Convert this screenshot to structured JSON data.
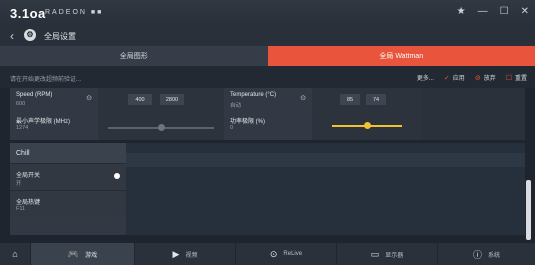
{
  "window": {
    "logo_mark": "3.1oa",
    "brand": "RADEON ■■",
    "controls": [
      "★",
      "—",
      "☐",
      "✕"
    ]
  },
  "nav": {
    "back": "‹",
    "global_icon": "⚙",
    "title": "全局设置"
  },
  "tabs": [
    {
      "label": "全局图形"
    },
    {
      "label": "全局 Wattman"
    }
  ],
  "toolbar": {
    "notice": "请在开始更改超频前验证...",
    "more": "更多...",
    "apply": "应用",
    "discard": "放弃",
    "reset": "重置"
  },
  "metrics": {
    "speed": {
      "label": "Speed (RPM)",
      "value": "600",
      "min": "400",
      "max": "2800"
    },
    "temperature": {
      "label": "Temperature (°C)",
      "value": "自动",
      "min": "85",
      "max": "74"
    },
    "min_noise": {
      "label": "最小声学极限 (MHz)",
      "value": "1274",
      "slider_level": 0.5
    },
    "power_limit": {
      "label": "功率极限 (%)",
      "value": "0",
      "slider_level": 0.5
    }
  },
  "chill": {
    "title": "Chill",
    "items": [
      {
        "title": "全局开关",
        "value": "开"
      },
      {
        "title": "全局热键",
        "value": "F11"
      }
    ]
  },
  "bottom_nav": [
    {
      "icon": "home-icon",
      "glyph": "⌂",
      "label": ""
    },
    {
      "icon": "gamepad-icon",
      "glyph": "🎮",
      "label": "游戏"
    },
    {
      "icon": "play-icon",
      "glyph": "▶",
      "label": "视频"
    },
    {
      "icon": "relive-icon",
      "glyph": "⊙",
      "label": "ReLive"
    },
    {
      "icon": "monitor-icon",
      "glyph": "▭",
      "label": "显示器"
    },
    {
      "icon": "info-icon",
      "glyph": "ⓘ",
      "label": "系统"
    }
  ],
  "colors": {
    "accent": "#e8543c",
    "slider_active": "#f2c230"
  }
}
